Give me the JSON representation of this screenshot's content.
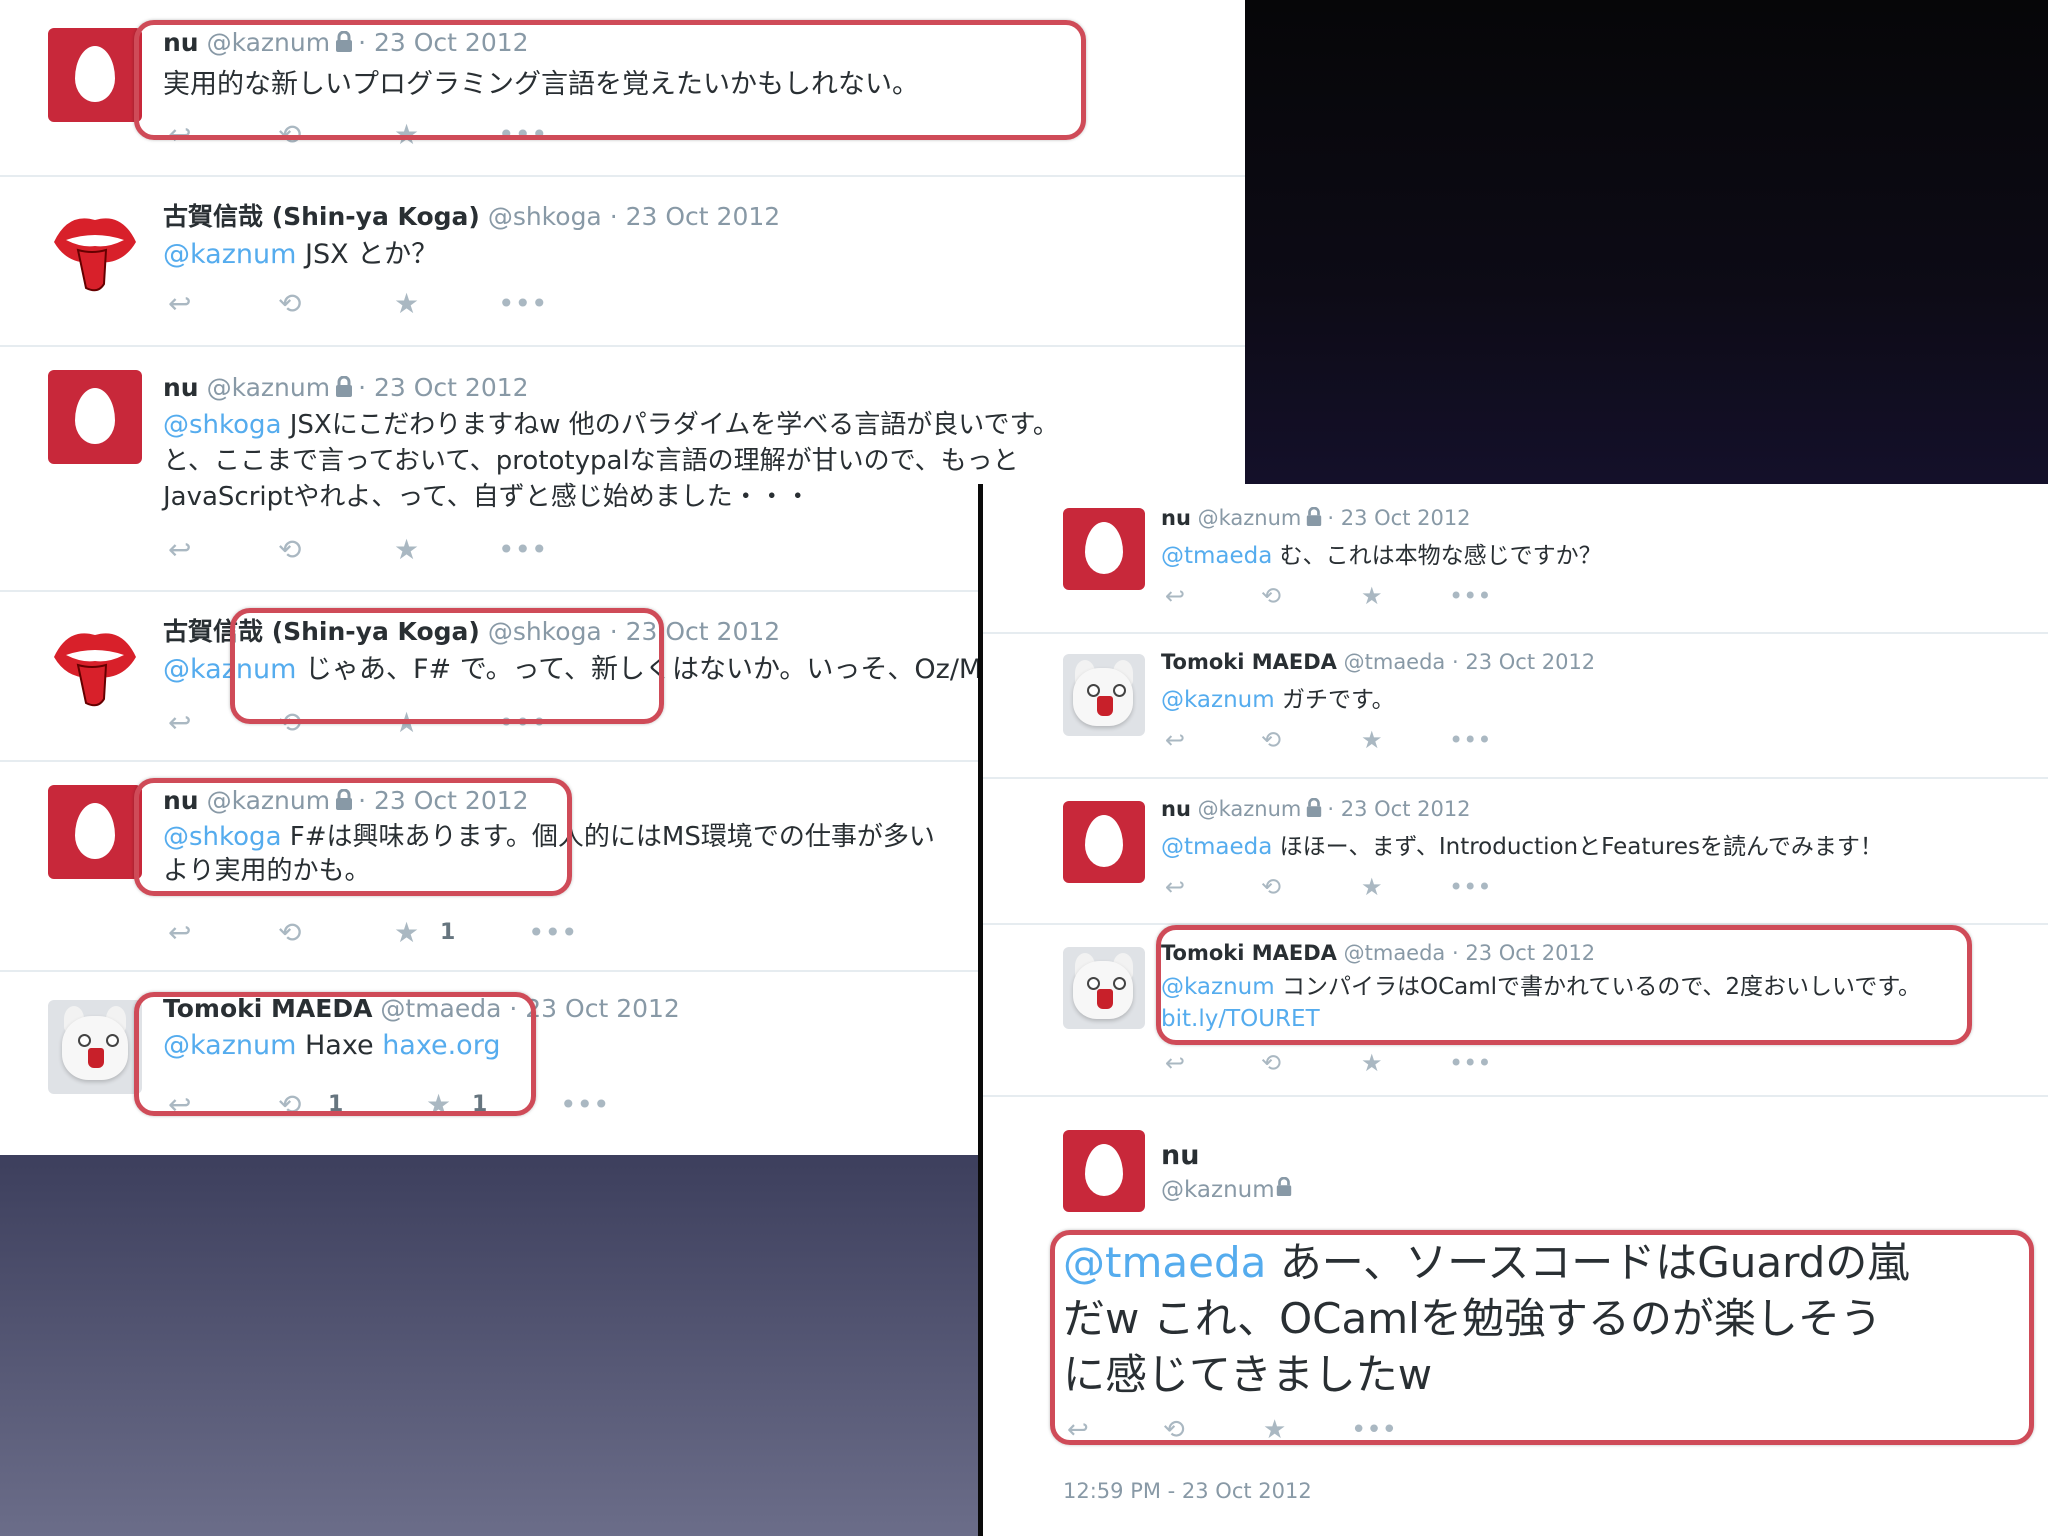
{
  "left_tweets": [
    {
      "name": "nu",
      "handle": "@kaznum",
      "date": "23 Oct 2012",
      "text": "実用的な新しいプログラミング言語を覚えたいかもしれない。",
      "mention": "",
      "fav_count": "",
      "rt_count": ""
    },
    {
      "name": "古賀信哉 (Shin-ya Koga)",
      "handle": "@shkoga",
      "date": "23 Oct 2012",
      "mention": "@kaznum",
      "text": " JSX とか？",
      "fav_count": "",
      "rt_count": ""
    },
    {
      "name": "nu",
      "handle": "@kaznum",
      "date": "23 Oct 2012",
      "mention": "@shkoga",
      "text": " JSXにこだわりますねw 他のパラダイムを学べる言語が良いです。\nと、ここまで言っておいて、prototypalな言語の理解が甘いので、もっと\nJavaScriptやれよ、って、自ずと感じ始めました・・・",
      "fav_count": "",
      "rt_count": ""
    },
    {
      "name": "古賀信哉 (Shin-ya Koga)",
      "handle": "@shkoga",
      "date": "23 Oct 2012",
      "mention": "@kaznum",
      "text": " じゃあ、F# で。って、新しくはないか。いっそ、Oz/M",
      "fav_count": "",
      "rt_count": ""
    },
    {
      "name": "nu",
      "handle": "@kaznum",
      "date": "23 Oct 2012",
      "mention": "@shkoga",
      "text": " F#は興味あります。個人的にはMS環境での仕事が多い\nより実用的かも。",
      "fav_count": "1",
      "rt_count": ""
    },
    {
      "name": "Tomoki MAEDA",
      "handle": "@tmaeda",
      "date": "23 Oct 2012",
      "mention": "@kaznum",
      "text": " Haxe ",
      "link": "haxe.org",
      "fav_count": "1",
      "rt_count": "1"
    }
  ],
  "right_tweets": [
    {
      "name": "nu",
      "handle": "@kaznum",
      "date": "23 Oct 2012",
      "mention": "@tmaeda",
      "text": " む、これは本物な感じですか？"
    },
    {
      "name": "Tomoki MAEDA",
      "handle": "@tmaeda",
      "date": "23 Oct 2012",
      "mention": "@kaznum",
      "text": " ガチです。"
    },
    {
      "name": "nu",
      "handle": "@kaznum",
      "date": "23 Oct 2012",
      "mention": "@tmaeda",
      "text": " ほほー、まず、IntroductionとFeaturesを読んでみます！"
    },
    {
      "name": "Tomoki MAEDA",
      "handle": "@tmaeda",
      "date": "23 Oct 2012",
      "mention": "@kaznum",
      "text": " コンパイラはOCamlで書かれているので、2度おいしいです。",
      "link": "bit.ly/TOURET"
    }
  ],
  "featured": {
    "name": "nu",
    "handle": "@kaznum",
    "mention": "@tmaeda",
    "text": " あー、ソースコードはGuardの嵐\nだw これ、OCamlを勉強するのが楽しそう\nに感じてきましたw",
    "timestamp": "12:59 PM - 23 Oct 2012"
  },
  "icons": {
    "reply": "↩",
    "retweet": "⟲",
    "favorite": "★",
    "more": "•••",
    "lock": "lock-icon"
  },
  "colors": {
    "callout": "#cf4b58",
    "mention": "#55acee",
    "egg_avatar": "#c8283a"
  }
}
